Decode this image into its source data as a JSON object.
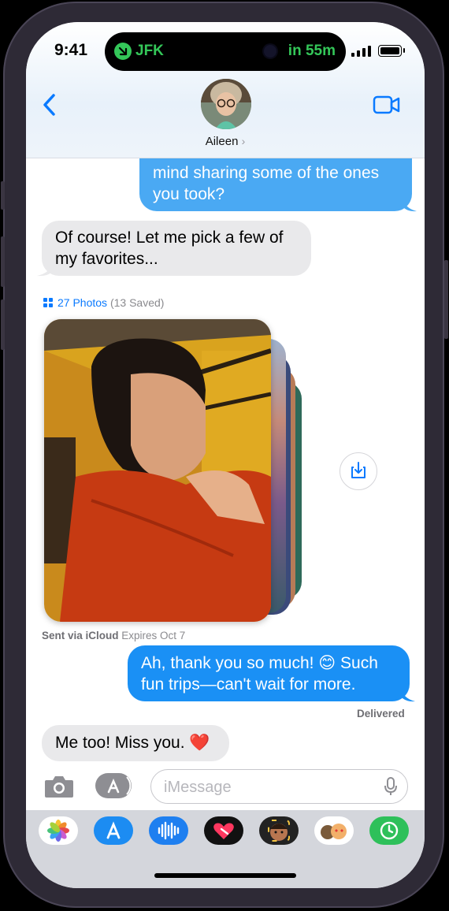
{
  "status_bar": {
    "time": "9:41",
    "activity_left": "JFK",
    "activity_right": "in 55m"
  },
  "header": {
    "contact_name": "Aileen",
    "chevron": "›"
  },
  "messages": {
    "m1_line1": "mind sharing some of the ones",
    "m1_line2": "you took?",
    "m2": "Of course! Let me pick a few of my favorites...",
    "photos_count": "27 Photos",
    "photos_saved": "(13 Saved)",
    "sent_via": "Sent via iCloud",
    "expires": "Expires Oct 7",
    "m3": "Ah, thank you so much! 😊 Such fun trips—can't wait for more.",
    "delivered": "Delivered",
    "m4": "Me too! Miss you. ❤️"
  },
  "composer": {
    "placeholder": "iMessage"
  },
  "app_drawer": [
    {
      "name": "photos-app-icon",
      "color": "#ffffff"
    },
    {
      "name": "app-store-app-icon",
      "color": "#1c8cf2"
    },
    {
      "name": "audio-app-icon",
      "color": "#1e7ff0"
    },
    {
      "name": "digital-touch-app-icon",
      "color": "#111111"
    },
    {
      "name": "memoji-app-icon",
      "color": "#222222"
    },
    {
      "name": "memoji-stickers-app-icon",
      "color": "#ffffff"
    },
    {
      "name": "find-my-app-icon",
      "color": "#2ec05a"
    }
  ],
  "colors": {
    "outgoing_bubble": "#1a90f5",
    "incoming_bubble": "#e9e9eb",
    "accent": "#0a7aff",
    "dynamic_island_text": "#34c759"
  }
}
